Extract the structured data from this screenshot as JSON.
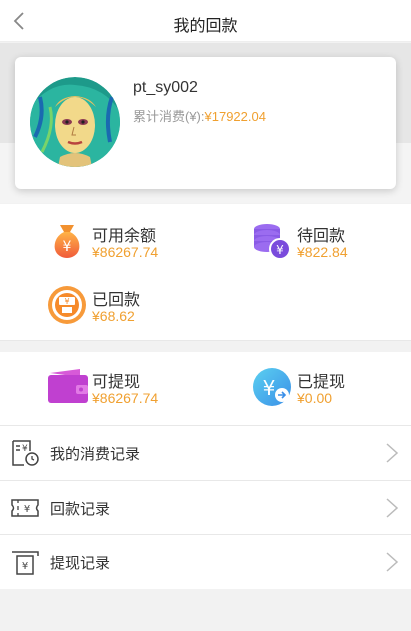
{
  "header": {
    "title": "我的回款"
  },
  "profile": {
    "username": "pt_sy002",
    "spend_label": "累计消费(¥):",
    "spend_amount": "¥17922.04"
  },
  "stats": [
    {
      "label": "可用余额",
      "value": "¥86267.74",
      "icon": "money-bag-icon"
    },
    {
      "label": "待回款",
      "value": "¥822.84",
      "icon": "coin-stack-icon"
    },
    {
      "label": "已回款",
      "value": "¥68.62",
      "icon": "returned-money-icon"
    }
  ],
  "withdraw": [
    {
      "label": "可提现",
      "value": "¥86267.74",
      "icon": "wallet-icon"
    },
    {
      "label": "已提现",
      "value": "¥0.00",
      "icon": "withdrawn-icon"
    }
  ],
  "menu": [
    {
      "label": "我的消费记录",
      "icon": "consumption-record-icon"
    },
    {
      "label": "回款记录",
      "icon": "ticket-yuan-icon"
    },
    {
      "label": "提现记录",
      "icon": "atm-withdraw-icon"
    }
  ],
  "colors": {
    "accent": "#f0a030"
  }
}
